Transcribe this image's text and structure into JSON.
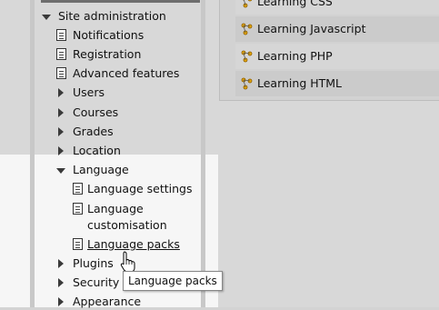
{
  "sidebar": {
    "site_administration": "Site administration",
    "items": {
      "notifications": "Notifications",
      "registration": "Registration",
      "advanced_features": "Advanced features",
      "users": "Users",
      "courses": "Courses",
      "grades": "Grades",
      "location": "Location",
      "language": "Language",
      "language_settings": "Language settings",
      "language_customisation_line1": "Language",
      "language_customisation_line2": "customisation",
      "language_packs": "Language packs",
      "plugins": "Plugins",
      "security": "Security",
      "appearance": "Appearance"
    }
  },
  "tooltip": {
    "text": "Language packs"
  },
  "courses": [
    {
      "label": "Learning CSS"
    },
    {
      "label": "Learning Javascript"
    },
    {
      "label": "Learning PHP"
    },
    {
      "label": "Learning HTML"
    }
  ]
}
